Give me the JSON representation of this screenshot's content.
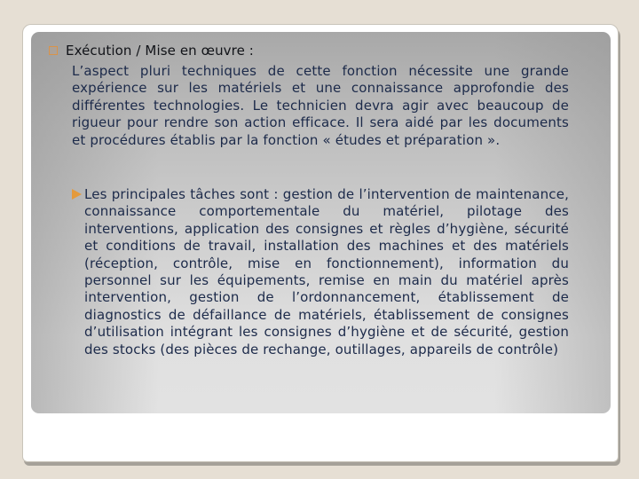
{
  "slide": {
    "heading": "Exécution / Mise en œuvre :",
    "paragraph": "L’aspect pluri techniques de cette fonction nécessite une grande expérience sur les matériels et une connaissance approfondie des différentes technologies. Le technicien devra agir avec beaucoup de rigueur pour rendre son action efficace. Il sera aidé par les documents et procédures établis par la fonction « études et préparation ».",
    "sub_bullet": "Les principales tâches sont : gestion de l’intervention de maintenance, connaissance comportementale du matériel, pilotage des interventions, application des consignes et règles d’hygiène, sécurité et conditions de travail, installation des machines et des matériels (réception, contrôle, mise en fonctionnement), information du personnel sur les équipements, remise en main du matériel après intervention, gestion de l’ordonnancement, établissement de diagnostics de défaillance de matériels, établissement de consignes d’utilisation intégrant les consignes d’hygiène et de sécurité, gestion des stocks (des pièces de rechange, outillages, appareils de contrôle)"
  },
  "icons": {
    "heading_bullet": "square-bullet-icon",
    "sub_bullet": "arrow-bullet-icon"
  },
  "colors": {
    "background": "#e6dfd4",
    "text": "#1c2a4a",
    "bullet_accent": "#e49a3c"
  }
}
